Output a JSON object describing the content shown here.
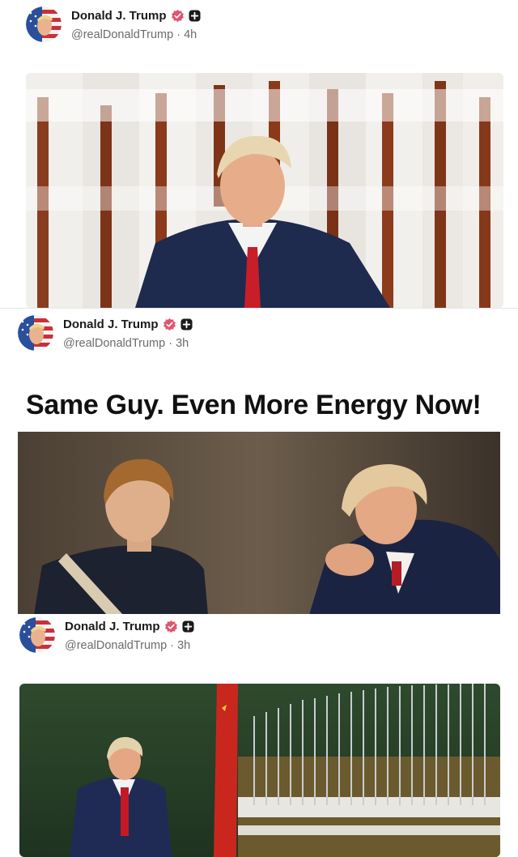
{
  "posts": [
    {
      "author": "Donald J. Trump",
      "handle": "@realDonaldTrump",
      "time": "4h",
      "text": "",
      "media_description": "honor-guard-photo"
    },
    {
      "author": "Donald J. Trump",
      "handle": "@realDonaldTrump",
      "time": "3h",
      "text": "Same Guy. Even More Energy Now!",
      "media_description": "young-and-older-portrait"
    },
    {
      "author": "Donald J. Trump",
      "handle": "@realDonaldTrump",
      "time": "3h",
      "text": "",
      "media_description": "troop-review-photo"
    }
  ],
  "colors": {
    "verified_badge": "#e0556f",
    "handle_text": "#6b6b6b",
    "name_text": "#1a1a1a"
  },
  "icons": [
    "verified-badge-icon",
    "plus-square-icon",
    "flag-avatar"
  ]
}
